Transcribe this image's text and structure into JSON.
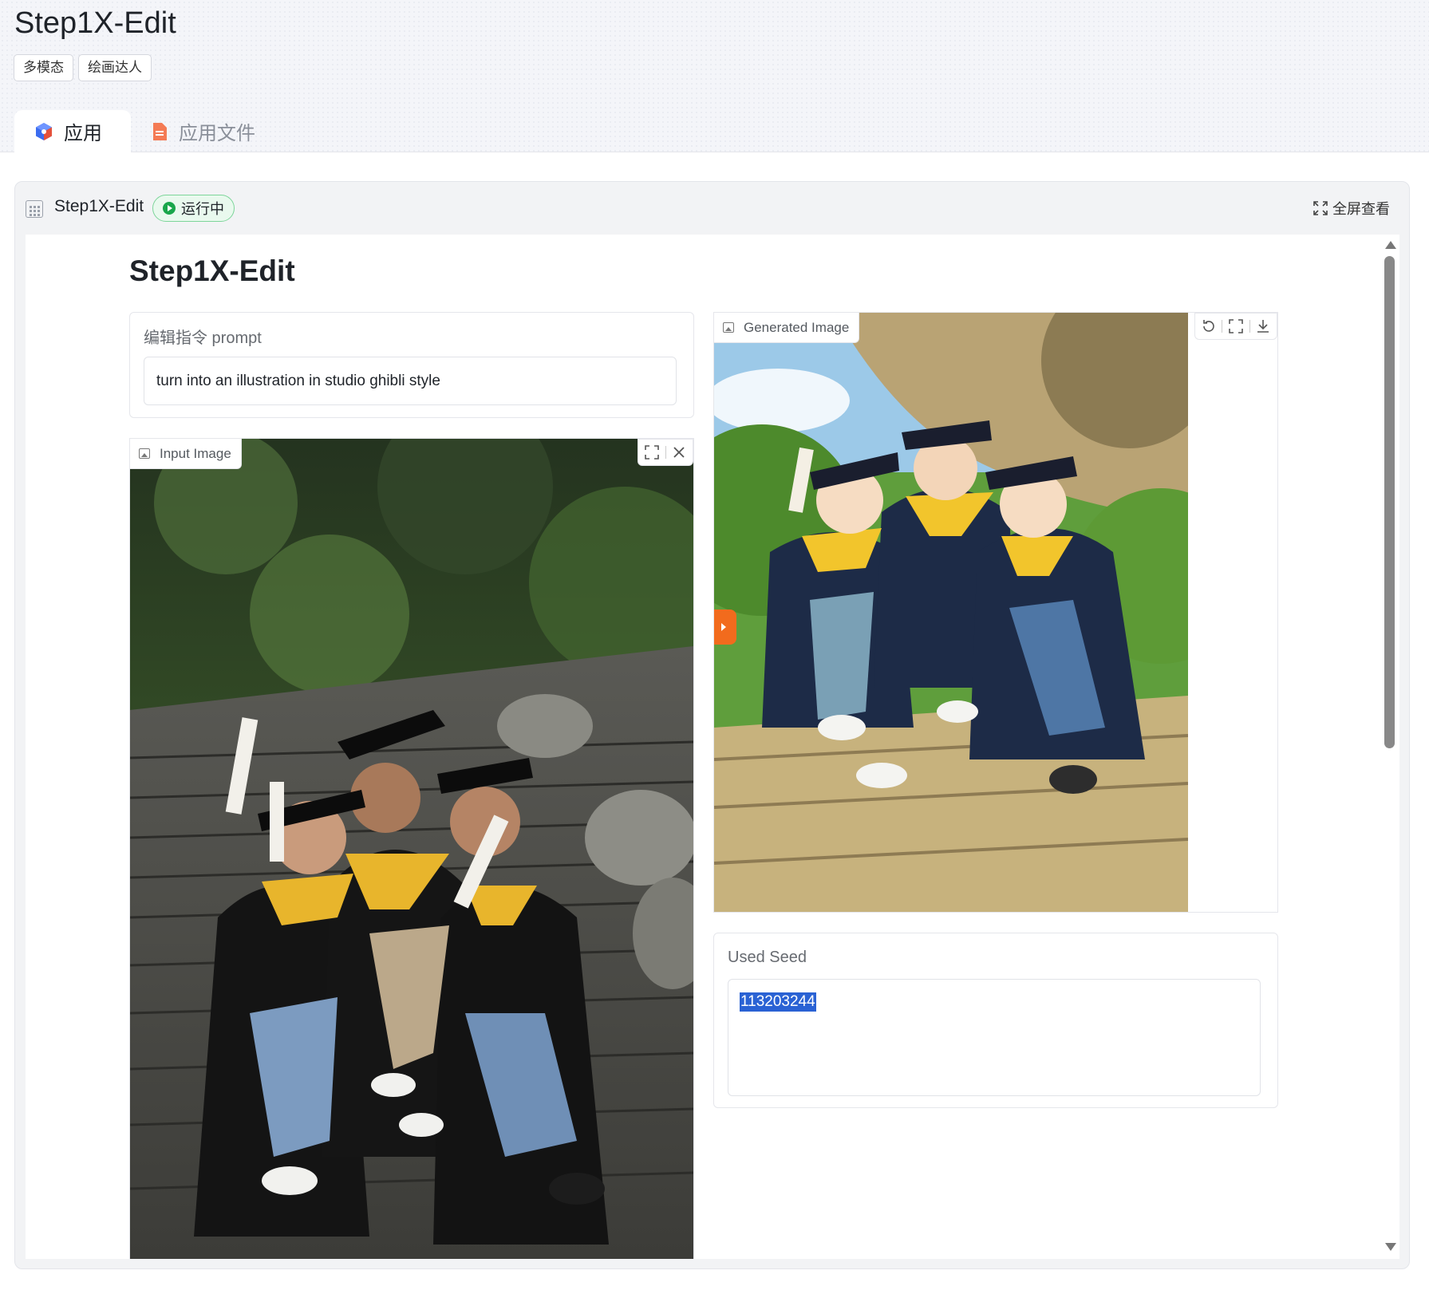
{
  "header": {
    "title": "Step1X-Edit",
    "tags": [
      "多模态",
      "绘画达人"
    ],
    "tabs": [
      {
        "label": "应用",
        "active": true,
        "icon": "app-cube-icon"
      },
      {
        "label": "应用文件",
        "active": false,
        "icon": "document-icon"
      }
    ]
  },
  "frame": {
    "app_name": "Step1X-Edit",
    "status": "运行中",
    "status_color": "#19a64b",
    "fullscreen_label": "全屏查看"
  },
  "app": {
    "heading": "Step1X-Edit",
    "prompt": {
      "label": "编辑指令 prompt",
      "value": "turn into an illustration in studio ghibli style"
    },
    "input_image": {
      "label": "Input Image"
    },
    "generated_image": {
      "label": "Generated Image"
    },
    "seed": {
      "label": "Used Seed",
      "value": "113203244"
    }
  },
  "colors": {
    "accent": "#f26b1d",
    "selection": "#2a62d4"
  }
}
